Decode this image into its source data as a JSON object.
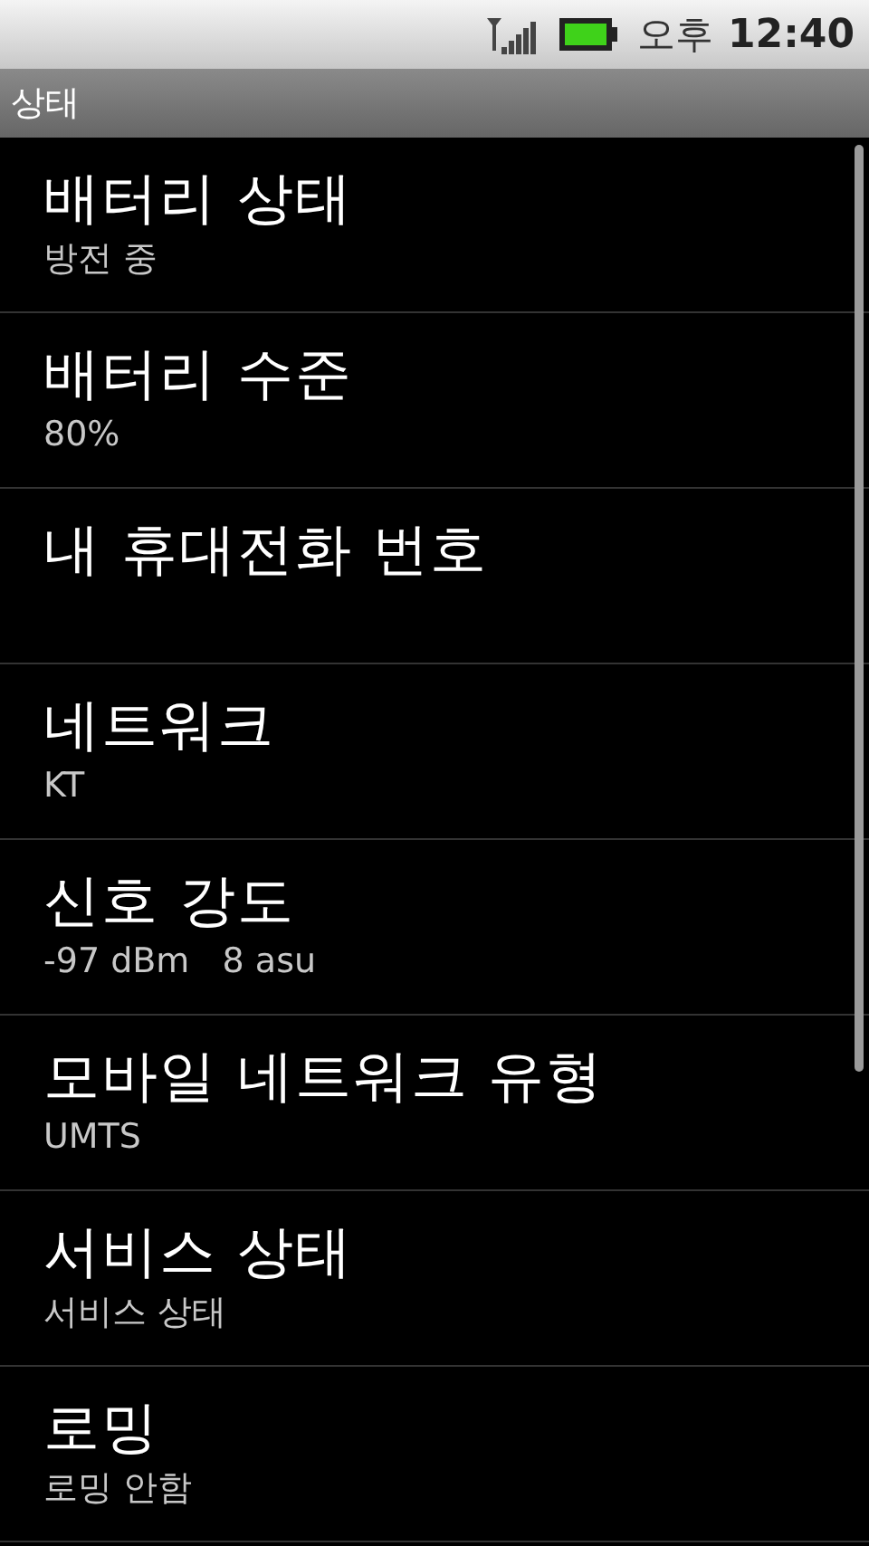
{
  "status_bar": {
    "ampm": "오후",
    "time": "12:40"
  },
  "title_bar": {
    "title": "상태"
  },
  "items": [
    {
      "title": "배터리 상태",
      "summary": "방전 중"
    },
    {
      "title": "배터리 수준",
      "summary": "80%"
    },
    {
      "title": "내 휴대전화 번호"
    },
    {
      "title": "네트워크",
      "summary": "KT"
    },
    {
      "title": "신호 강도",
      "summary": "-97 dBm   8 asu"
    },
    {
      "title": "모바일 네트워크 유형",
      "summary": "UMTS"
    },
    {
      "title": "서비스 상태",
      "summary": "서비스 상태"
    },
    {
      "title": "로밍",
      "summary": "로밍 안함"
    }
  ]
}
